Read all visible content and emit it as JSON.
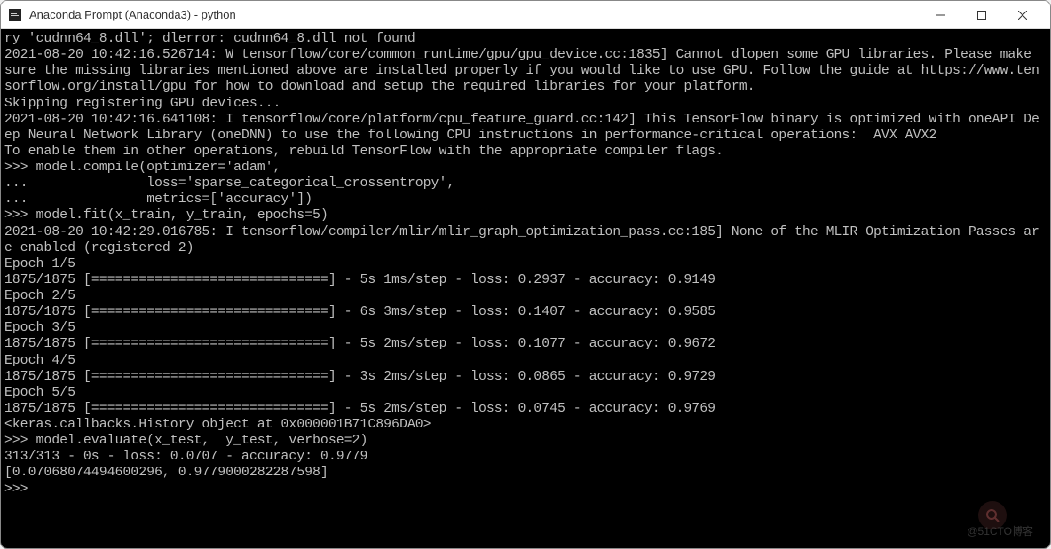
{
  "window": {
    "title": "Anaconda Prompt (Anaconda3) - python"
  },
  "terminal": {
    "lines": [
      "ry 'cudnn64_8.dll'; dlerror: cudnn64_8.dll not found",
      "2021-08-20 10:42:16.526714: W tensorflow/core/common_runtime/gpu/gpu_device.cc:1835] Cannot dlopen some GPU libraries. Please make sure the missing libraries mentioned above are installed properly if you would like to use GPU. Follow the guide at https://www.tensorflow.org/install/gpu for how to download and setup the required libraries for your platform.",
      "Skipping registering GPU devices...",
      "2021-08-20 10:42:16.641108: I tensorflow/core/platform/cpu_feature_guard.cc:142] This TensorFlow binary is optimized with oneAPI Deep Neural Network Library (oneDNN) to use the following CPU instructions in performance-critical operations:  AVX AVX2",
      "To enable them in other operations, rebuild TensorFlow with the appropriate compiler flags.",
      ">>> model.compile(optimizer='adam',",
      "...               loss='sparse_categorical_crossentropy',",
      "...               metrics=['accuracy'])",
      ">>> model.fit(x_train, y_train, epochs=5)",
      "2021-08-20 10:42:29.016785: I tensorflow/compiler/mlir/mlir_graph_optimization_pass.cc:185] None of the MLIR Optimization Passes are enabled (registered 2)",
      "Epoch 1/5",
      "1875/1875 [==============================] - 5s 1ms/step - loss: 0.2937 - accuracy: 0.9149",
      "Epoch 2/5",
      "1875/1875 [==============================] - 6s 3ms/step - loss: 0.1407 - accuracy: 0.9585",
      "Epoch 3/5",
      "1875/1875 [==============================] - 5s 2ms/step - loss: 0.1077 - accuracy: 0.9672",
      "Epoch 4/5",
      "1875/1875 [==============================] - 3s 2ms/step - loss: 0.0865 - accuracy: 0.9729",
      "Epoch 5/5",
      "1875/1875 [==============================] - 5s 2ms/step - loss: 0.0745 - accuracy: 0.9769",
      "<keras.callbacks.History object at 0x000001B71C896DA0>",
      ">>> model.evaluate(x_test,  y_test, verbose=2)",
      "313/313 - 0s - loss: 0.0707 - accuracy: 0.9779",
      "[0.07068074494600296, 0.9779000282287598]",
      ">>>"
    ]
  },
  "watermark": "@51CTO博客"
}
